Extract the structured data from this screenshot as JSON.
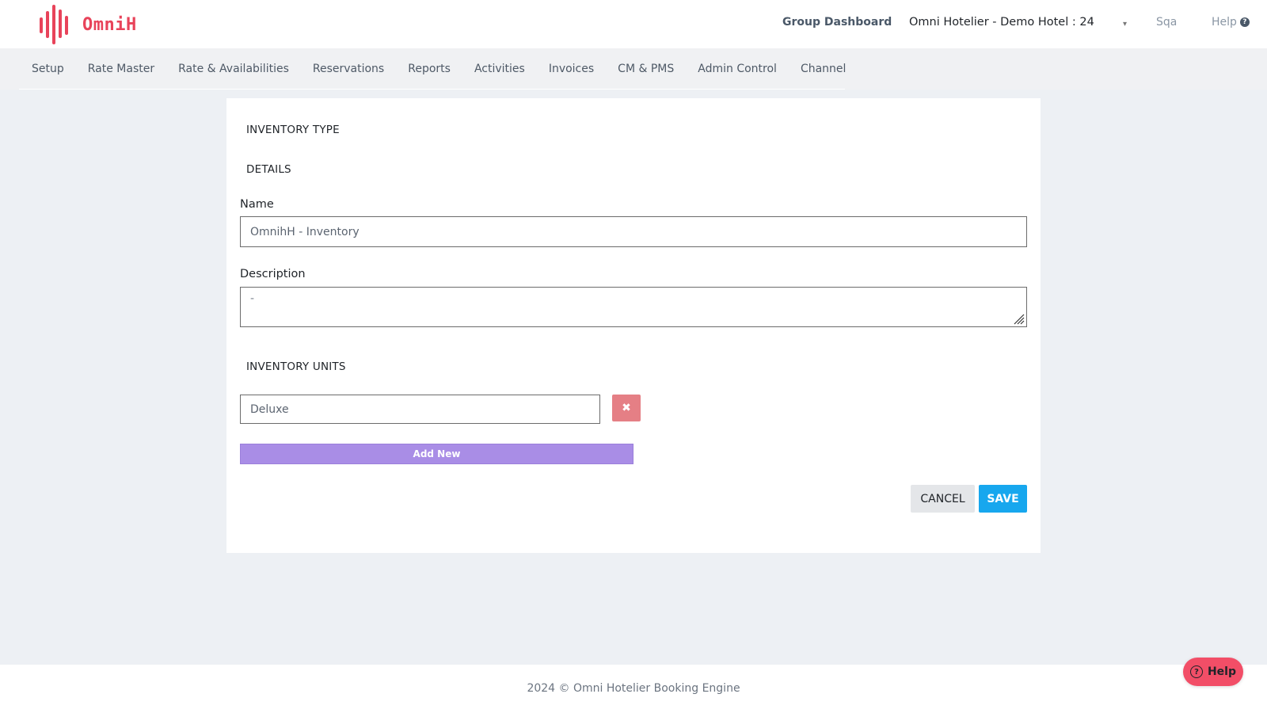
{
  "header": {
    "logo_text": "OmniH",
    "group_dashboard": "Group Dashboard",
    "hotel_select": "Omni Hotelier - Demo Hotel : 24",
    "caret": "▾",
    "user": "Sqa",
    "help": "Help",
    "help_icon": "?"
  },
  "nav": {
    "items": [
      {
        "label": "Setup"
      },
      {
        "label": "Rate Master"
      },
      {
        "label": "Rate & Availabilities"
      },
      {
        "label": "Reservations"
      },
      {
        "label": "Reports"
      },
      {
        "label": "Activities"
      },
      {
        "label": "Invoices"
      },
      {
        "label": "CM & PMS"
      },
      {
        "label": "Admin Control"
      },
      {
        "label": "Channel"
      }
    ]
  },
  "form": {
    "section_inventory_type": "INVENTORY TYPE",
    "section_details": "DETAILS",
    "name_label": "Name",
    "name_value": "OmnihH - Inventory",
    "description_label": "Description",
    "description_value": "-",
    "section_units": "INVENTORY UNITS",
    "units": [
      {
        "value": "Deluxe"
      }
    ],
    "remove_icon": "✖",
    "add_new_label": "Add New",
    "cancel_label": "CANCEL",
    "save_label": "SAVE"
  },
  "footer": {
    "text": "2024 © Omni Hotelier Booking Engine"
  },
  "help_widget": {
    "icon": "?",
    "label": "Help"
  },
  "colors": {
    "brand": "#e8435a",
    "save": "#17a7ee",
    "add_new": "#a98de6",
    "remove": "#e57f85",
    "help_widget": "#f24e67"
  }
}
